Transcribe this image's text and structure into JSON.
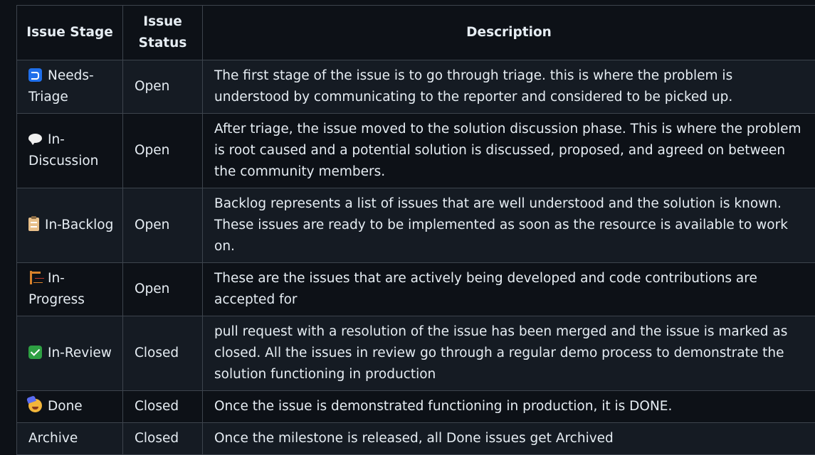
{
  "table": {
    "headers": {
      "stage": "Issue Stage",
      "status": "Issue Status",
      "description": "Description"
    },
    "rows": [
      {
        "icon": "leftwards-arrow-with-hook-icon",
        "stage": "Needs-Triage",
        "status": "Open",
        "description": "The first stage of the issue is to go through triage. this is where the problem is understood by communicating to the reporter and considered to be picked up."
      },
      {
        "icon": "speech-balloon-icon",
        "stage": "In-Discussion",
        "status": "Open",
        "description": "After triage, the issue moved to the solution discussion phase. This is where the problem is root caused and a potential solution is discussed, proposed, and agreed on between the community members."
      },
      {
        "icon": "clipboard-icon",
        "stage": "In-Backlog",
        "status": "Open",
        "description": "Backlog represents a list of issues that are well understood and the solution is known. These issues are ready to be implemented as soon as the resource is available to work on."
      },
      {
        "icon": "building-construction-icon",
        "stage": "In-Progress",
        "status": "Open",
        "description": "These are the issues that are actively being developed and code contributions are accepted for"
      },
      {
        "icon": "check-mark-button-icon",
        "stage": "In-Review",
        "status": "Closed",
        "description": "pull request with a resolution of the issue has been merged and the issue is marked as closed. All the issues in review go through a regular demo process to demonstrate the solution functioning in production"
      },
      {
        "icon": "partying-face-icon",
        "stage": "Done",
        "status": "Closed",
        "description": "Once the issue is demonstrated functioning in production, it is DONE."
      },
      {
        "icon": "",
        "stage": "Archive",
        "status": "Closed",
        "description": "Once the milestone is released, all Done issues get Archived"
      }
    ]
  }
}
